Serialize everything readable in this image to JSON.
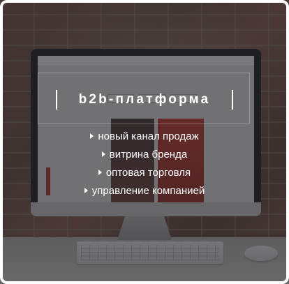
{
  "banner": {
    "title": "b2b-платформа",
    "features": [
      "новый канал продаж",
      "витрина бренда",
      "оптовая торговля",
      "управление компанией"
    ],
    "icons": {
      "bullet": "triangle-right-icon"
    }
  }
}
